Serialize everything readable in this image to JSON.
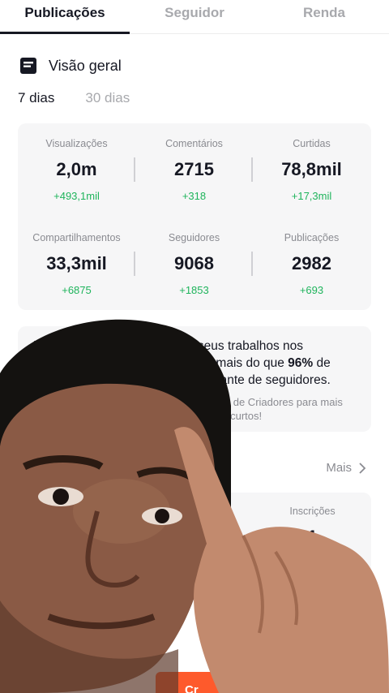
{
  "tabs": [
    {
      "label": "Publicações",
      "active": true
    },
    {
      "label": "Seguidor",
      "active": false
    },
    {
      "label": "Renda",
      "active": false
    }
  ],
  "overview": {
    "icon": "document-icon",
    "title": "Visão geral"
  },
  "range": [
    {
      "label": "7 dias",
      "active": true
    },
    {
      "label": "30 dias",
      "active": false
    }
  ],
  "stats": [
    {
      "label": "Visualizações",
      "value": "2,0m",
      "delta": "+493,1mil"
    },
    {
      "label": "Comentários",
      "value": "2715",
      "delta": "+318"
    },
    {
      "label": "Curtidas",
      "value": "78,8mil",
      "delta": "+17,3mil"
    },
    {
      "label": "Compartilhamentos",
      "value": "33,3mil",
      "delta": "+6875"
    },
    {
      "label": "Seguidores",
      "value": "9068",
      "delta": "+1853"
    },
    {
      "label": "Publicações",
      "value": "2982",
      "delta": "+693"
    }
  ],
  "insight": {
    "line1": "As no   ualizações de todos os seus trabalhos nos",
    "line2_part": "mil, mais do que",
    "percent": "96%",
    "line2_end": "de",
    "line3": "melhante de seguidores.",
    "sub1": "ia de Criadores para mais",
    "sub2": "s curtos!"
  },
  "more": {
    "label": "Mais"
  },
  "inscricoes": {
    "label": "Inscrições",
    "value": "1"
  },
  "cta": {
    "label": "Cr"
  },
  "colors": {
    "positive": "#1fb45c",
    "accent": "#fe5a2c",
    "card": "#f6f6f7"
  }
}
